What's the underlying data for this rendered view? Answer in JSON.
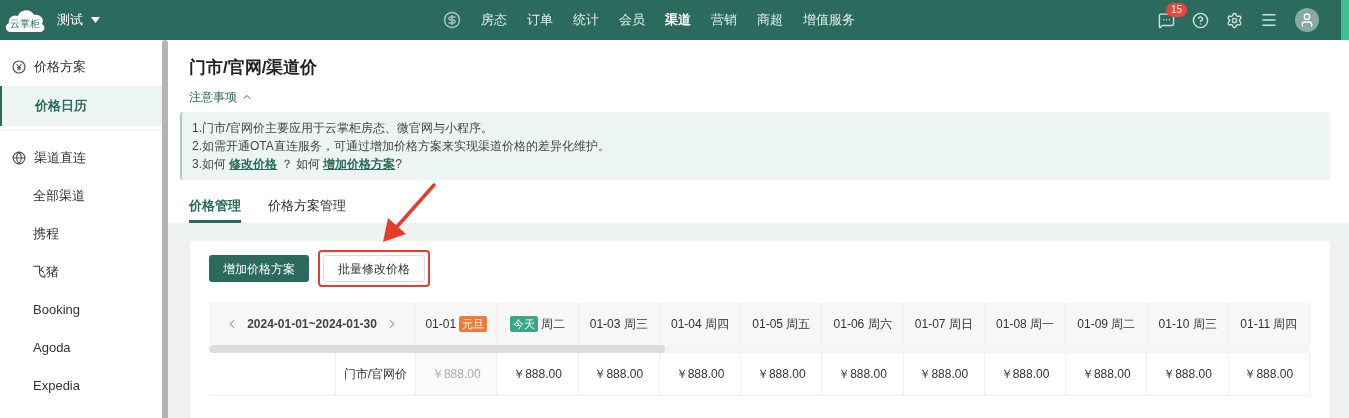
{
  "topbar": {
    "logo": "云掌柜",
    "project": "测试",
    "message_count": "15",
    "nav": [
      {
        "label": "房态",
        "selected": false
      },
      {
        "label": "订单",
        "selected": false
      },
      {
        "label": "统计",
        "selected": false
      },
      {
        "label": "会员",
        "selected": false
      },
      {
        "label": "渠道",
        "selected": true
      },
      {
        "label": "营销",
        "selected": false
      },
      {
        "label": "商超",
        "selected": false
      },
      {
        "label": "增值服务",
        "selected": false
      }
    ]
  },
  "sidebar": [
    {
      "label": "价格方案",
      "kind": "pricing",
      "children": [
        {
          "label": "价格日历",
          "selected": true
        }
      ]
    },
    {
      "label": "渠道直连",
      "kind": "channels",
      "children": [
        {
          "label": "全部渠道",
          "selected": false
        },
        {
          "label": "携程",
          "selected": false
        },
        {
          "label": "飞猪",
          "selected": false
        },
        {
          "label": "Booking",
          "selected": false
        },
        {
          "label": "Agoda",
          "selected": false
        },
        {
          "label": "Expedia",
          "selected": false
        }
      ]
    }
  ],
  "page": {
    "title": "门市/官网/渠道价",
    "notice_toggle": "注意事项",
    "expanded": true,
    "notice_lines": [
      [
        {
          "kind": "text",
          "text": "1.门市/官网价主要应用于云掌柜房态、微官网与小程序。"
        }
      ],
      [
        {
          "kind": "text",
          "text": "2.如需开通OTA直连服务，可通过增加价格方案来实现渠道价格的差异化维护。"
        }
      ],
      [
        {
          "kind": "text",
          "text": "3.如何 "
        },
        {
          "kind": "link",
          "text": "修改价格"
        },
        {
          "kind": "text",
          "text": " ？ 如何 "
        },
        {
          "kind": "link",
          "text": "增加价格方案"
        },
        {
          "kind": "text",
          "text": "?"
        }
      ]
    ]
  },
  "tabs": [
    {
      "label": "价格管理",
      "selected": true
    },
    {
      "label": "价格方案管理",
      "selected": false
    }
  ],
  "actions": [
    {
      "label": "增加价格方案",
      "kind": "primary",
      "highlighted": false
    },
    {
      "label": "批量修改价格",
      "kind": "default",
      "highlighted": true
    }
  ],
  "table": {
    "range": "2024-01-01~2024-01-30",
    "columns": [
      {
        "parts": [
          {
            "kind": "text",
            "text": "01-01"
          },
          {
            "kind": "badge",
            "text": "元旦",
            "color": "#f07a3a"
          }
        ]
      },
      {
        "parts": [
          {
            "kind": "badge",
            "text": "今天",
            "color": "#3aa58a"
          },
          {
            "kind": "text",
            "text": "周二"
          }
        ]
      },
      {
        "parts": [
          {
            "kind": "text",
            "text": "01-03 周三"
          }
        ]
      },
      {
        "parts": [
          {
            "kind": "text",
            "text": "01-04 周四"
          }
        ]
      },
      {
        "parts": [
          {
            "kind": "text",
            "text": "01-05 周五"
          }
        ]
      },
      {
        "parts": [
          {
            "kind": "text",
            "text": "01-06 周六"
          }
        ]
      },
      {
        "parts": [
          {
            "kind": "text",
            "text": "01-07 周日"
          }
        ]
      },
      {
        "parts": [
          {
            "kind": "text",
            "text": "01-08 周一"
          }
        ]
      },
      {
        "parts": [
          {
            "kind": "text",
            "text": "01-09 周二"
          }
        ]
      },
      {
        "parts": [
          {
            "kind": "text",
            "text": "01-10 周三"
          }
        ]
      },
      {
        "parts": [
          {
            "kind": "text",
            "text": "01-11 周四"
          }
        ]
      }
    ],
    "rows": [
      {
        "label": "门市/官网价",
        "cells": [
          {
            "value": "￥888.00",
            "muted": true
          },
          {
            "value": "￥888.00",
            "muted": false
          },
          {
            "value": "￥888.00",
            "muted": false
          },
          {
            "value": "￥888.00",
            "muted": false
          },
          {
            "value": "￥888.00",
            "muted": false
          },
          {
            "value": "￥888.00",
            "muted": false
          },
          {
            "value": "￥888.00",
            "muted": false
          },
          {
            "value": "￥888.00",
            "muted": false
          },
          {
            "value": "￥888.00",
            "muted": false
          },
          {
            "value": "￥888.00",
            "muted": false
          },
          {
            "value": "￥888.00",
            "muted": false
          }
        ]
      }
    ]
  }
}
